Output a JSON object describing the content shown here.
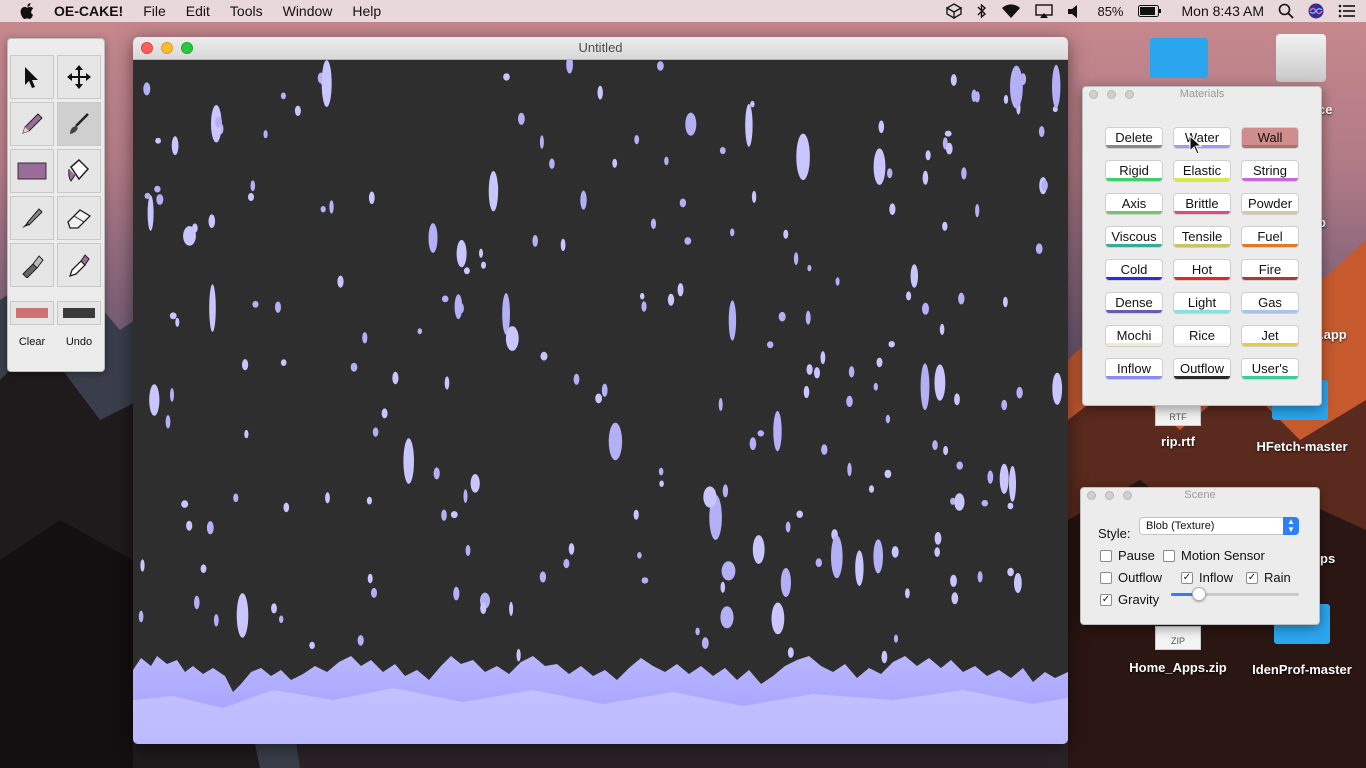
{
  "menubar": {
    "app_name": "OE-CAKE!",
    "items": [
      "File",
      "Edit",
      "Tools",
      "Window",
      "Help"
    ],
    "battery": "85%",
    "clock": "Mon 8:43 AM",
    "status_icons": [
      "dropbox-icon",
      "bluetooth-icon",
      "wifi-icon",
      "airplay-icon",
      "volume-icon",
      "battery-icon",
      "search-icon",
      "siri-icon",
      "list-icon"
    ]
  },
  "desktop": {
    "icons": [
      {
        "label": "rip.rtf",
        "kind": "RTF"
      },
      {
        "label": "HFetch-master",
        "kind": "folder"
      },
      {
        "label": "Home_Apps.zip",
        "kind": "ZIP"
      },
      {
        "label": "IdenProf-master",
        "kind": "folder"
      }
    ],
    "partial_labels": [
      "ce",
      "p",
      ".app",
      "ps"
    ]
  },
  "palette": {
    "tools": [
      "arrow-icon",
      "move-icon",
      "pencil-icon",
      "brush-icon",
      "rectangle-icon",
      "paint-bucket-icon",
      "knife-icon",
      "eraser-icon",
      "flashlight-icon",
      "eyedropper-icon"
    ],
    "primary_color": "#cd7272",
    "secondary_color": "#3a3a3a",
    "clear_label": "Clear",
    "undo_label": "Undo"
  },
  "window": {
    "title": "Untitled"
  },
  "materials": {
    "title": "Materials",
    "active": "Wall",
    "buttons": [
      {
        "label": "Delete",
        "color": "#888888"
      },
      {
        "label": "Water",
        "color": "#9c9cf0"
      },
      {
        "label": "Wall",
        "color": "#b07070"
      },
      {
        "label": "Rigid",
        "color": "#3fcf6a"
      },
      {
        "label": "Elastic",
        "color": "#d6e84a"
      },
      {
        "label": "String",
        "color": "#c46ad8"
      },
      {
        "label": "Axis",
        "color": "#6fc86a"
      },
      {
        "label": "Brittle",
        "color": "#e04a8a"
      },
      {
        "label": "Powder",
        "color": "#d8c8a6"
      },
      {
        "label": "Viscous",
        "color": "#3aa89a"
      },
      {
        "label": "Tensile",
        "color": "#c9c26a"
      },
      {
        "label": "Fuel",
        "color": "#e07a2a"
      },
      {
        "label": "Cold",
        "color": "#2d2dd8"
      },
      {
        "label": "Hot",
        "color": "#e02a2a"
      },
      {
        "label": "Fire",
        "color": "#a83a3a"
      },
      {
        "label": "Dense",
        "color": "#6a5ab0"
      },
      {
        "label": "Light",
        "color": "#8ae0e0"
      },
      {
        "label": "Gas",
        "color": "#aac4e8"
      },
      {
        "label": "Mochi",
        "color": "#f0ecd0"
      },
      {
        "label": "Rice",
        "color": "#f4f4f4"
      },
      {
        "label": "Jet",
        "color": "#f0c830"
      },
      {
        "label": "Inflow",
        "color": "#8c8cf0"
      },
      {
        "label": "Outflow",
        "color": "#2a2a2a"
      },
      {
        "label": "User's",
        "color": "#3acf9a"
      }
    ]
  },
  "scene": {
    "title": "Scene",
    "style_label": "Style:",
    "style_value": "Blob (Texture)",
    "checkboxes": {
      "pause": {
        "label": "Pause",
        "checked": false
      },
      "motion_sensor": {
        "label": "Motion Sensor",
        "checked": false
      },
      "outflow": {
        "label": "Outflow",
        "checked": false
      },
      "inflow": {
        "label": "Inflow",
        "checked": true
      },
      "rain": {
        "label": "Rain",
        "checked": true
      },
      "gravity": {
        "label": "Gravity",
        "checked": true
      }
    },
    "gravity_level": 0.22
  }
}
